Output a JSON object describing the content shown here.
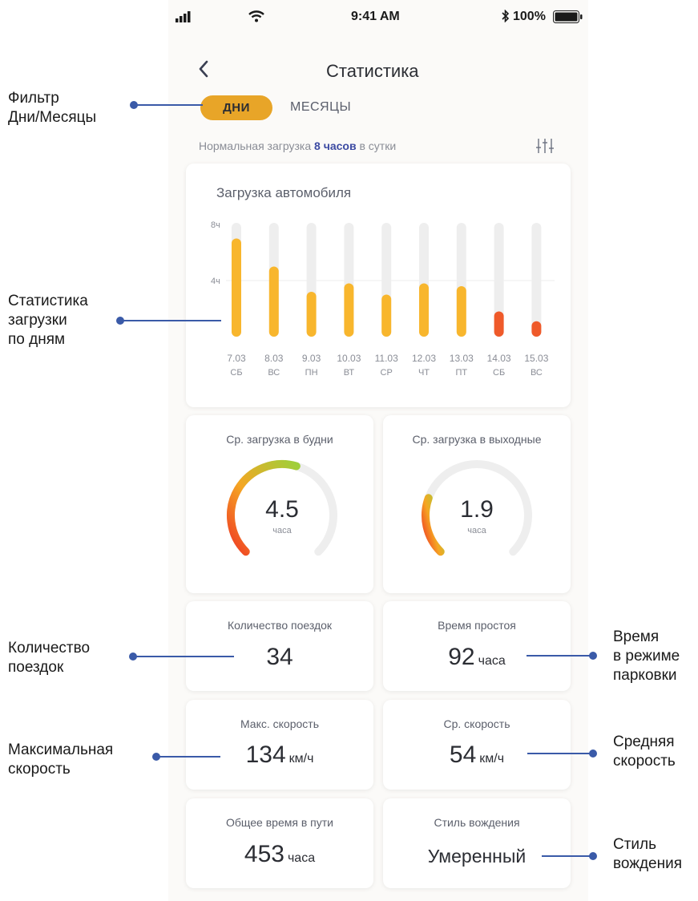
{
  "status_bar": {
    "time": "9:41 AM",
    "battery": "100%"
  },
  "header": {
    "title": "Статистика",
    "back_icon": "chevron-left-icon"
  },
  "filter": {
    "days": "ДНИ",
    "months": "МЕСЯЦЫ"
  },
  "normal_load": {
    "prefix": "Нормальная загрузка",
    "value": "8 часов",
    "suffix": "в сутки"
  },
  "chart_data": {
    "type": "bar",
    "title": "Загрузка автомобиля",
    "y_ticks": [
      "8ч",
      "4ч"
    ],
    "ylim": [
      0,
      8
    ],
    "categories": [
      "7.03",
      "8.03",
      "9.03",
      "10.03",
      "11.03",
      "12.03",
      "13.03",
      "14.03",
      "15.03"
    ],
    "weekdays": [
      "СБ",
      "ВС",
      "ПН",
      "ВТ",
      "СР",
      "ЧТ",
      "ПТ",
      "СБ",
      "ВС"
    ],
    "values": [
      7.0,
      5.0,
      3.2,
      3.8,
      3.0,
      3.8,
      3.6,
      1.8,
      1.1
    ],
    "colors": [
      "#f8b62d",
      "#f8b62d",
      "#f8b62d",
      "#f8b62d",
      "#f8b62d",
      "#f8b62d",
      "#f8b62d",
      "#ef5a2a",
      "#ef5a2a"
    ]
  },
  "weekday_avg": {
    "title": "Ср. загрузка в будни",
    "value": "4.5",
    "unit": "часа",
    "fraction": 0.56
  },
  "weekend_avg": {
    "title": "Ср. загрузка в выходные",
    "value": "1.9",
    "unit": "часа",
    "fraction": 0.24
  },
  "trips": {
    "title": "Количество поездок",
    "value": "34"
  },
  "idle": {
    "title": "Время простоя",
    "value": "92",
    "unit": "часа"
  },
  "max_speed": {
    "title": "Макс. скорость",
    "value": "134",
    "unit": "км/ч"
  },
  "avg_speed": {
    "title": "Ср. скорость",
    "value": "54",
    "unit": "км/ч"
  },
  "total_time": {
    "title": "Общее время в пути",
    "value": "453",
    "unit": "часа"
  },
  "driving_style": {
    "title": "Стиль вождения",
    "value": "Умеренный"
  },
  "annotations": {
    "filter": "Фильтр\nДни/Месяцы",
    "daily_stats": "Статистика\nзагрузки\nпо дням",
    "trips": "Количество\nпоездок",
    "max_speed": "Максимальная\nскорость",
    "parking": "Время\nв режиме\nпарковки",
    "avg_speed": "Средняя\nскорость",
    "style": "Стиль\nвождения"
  },
  "colors": {
    "accent": "#e8a528",
    "annotation_line": "#3a5aa8",
    "bar_normal": "#f8b62d",
    "bar_low": "#ef5a2a"
  }
}
